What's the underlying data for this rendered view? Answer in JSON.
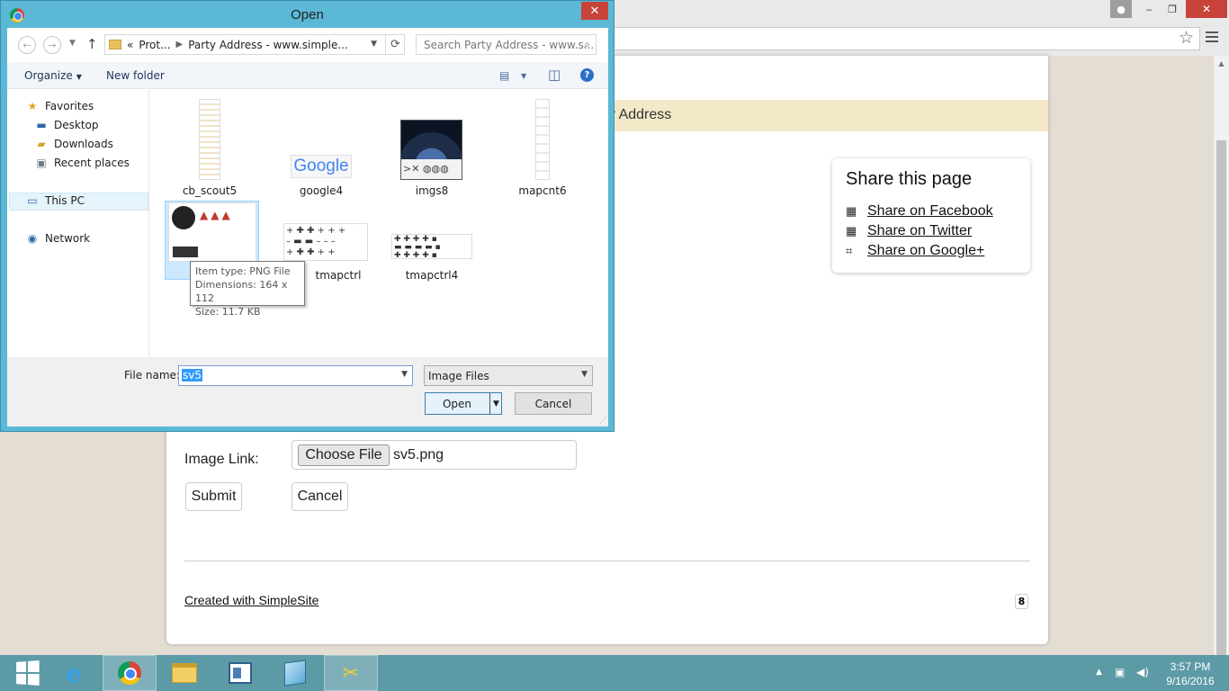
{
  "browser": {
    "window_buttons": {
      "minimize": "‒",
      "restore": "❐",
      "close": "✕"
    }
  },
  "page": {
    "title_band": "y Address",
    "share": {
      "title": "Share this page",
      "links": [
        {
          "label": "Share on Facebook",
          "icon": "facebook-icon"
        },
        {
          "label": "Share on Twitter",
          "icon": "twitter-icon"
        },
        {
          "label": "Share on Google+",
          "icon": "google-plus-icon"
        }
      ]
    },
    "form": {
      "image_link_label": "Image Link:",
      "choose_file_label": "Choose File",
      "chosen_file": "sv5.png",
      "submit_label": "Submit",
      "cancel_label": "Cancel"
    },
    "footer": {
      "credit": "Created with SimpleSite",
      "badge": "8"
    }
  },
  "dialog": {
    "title": "Open",
    "address": {
      "prefix": "«",
      "crumbs": [
        "Prot...",
        "Party Address - www.simple..."
      ]
    },
    "search_placeholder": "Search Party Address - www.s...",
    "commands": {
      "organize": "Organize",
      "new_folder": "New folder"
    },
    "nav": {
      "favorites": "Favorites",
      "desktop": "Desktop",
      "downloads": "Downloads",
      "recent": "Recent places",
      "this_pc": "This PC",
      "network": "Network"
    },
    "files": [
      {
        "name": "cb_scout5"
      },
      {
        "name": "google4"
      },
      {
        "name": "imgs8"
      },
      {
        "name": "mapcnt6"
      },
      {
        "name": "sv5"
      },
      {
        "name": "tmapctrl"
      },
      {
        "name": "tmapctrl4"
      }
    ],
    "google_logo_text": "Google",
    "tooltip": {
      "type": "Item type: PNG File",
      "dimensions": "Dimensions: 164 x 112",
      "size": "Size: 11.7 KB"
    },
    "file_name_label": "File name:",
    "file_name_value": "sv5",
    "file_type": "Image Files",
    "open_label": "Open",
    "cancel_label": "Cancel"
  },
  "taskbar": {
    "time": "3:57 PM",
    "date": "9/16/2016"
  }
}
